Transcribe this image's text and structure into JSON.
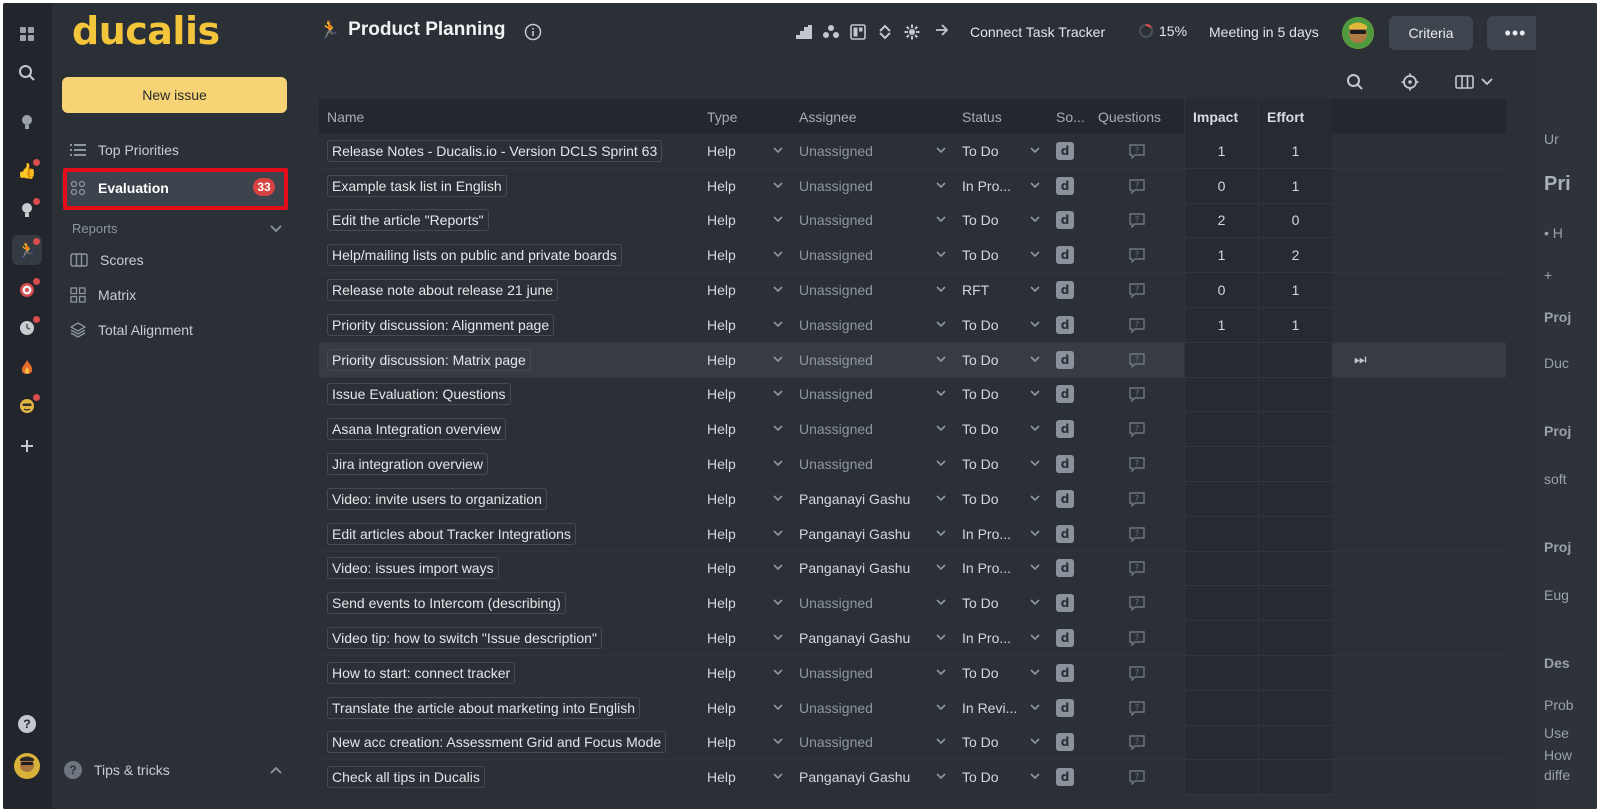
{
  "rail": {
    "icons": [
      "grid-icon",
      "search-icon",
      "bulb-icon",
      "thumbs-up-icon",
      "bulb-alert-icon",
      "runner-icon",
      "target-icon",
      "clock-icon",
      "fire-icon",
      "face-icon",
      "plus-icon",
      "help-icon",
      "user-avatar"
    ],
    "help_label": "?"
  },
  "sidebar": {
    "logo": "ducalis",
    "new_issue": "New issue",
    "items": [
      {
        "label": "Top Priorities"
      },
      {
        "label": "Evaluation",
        "badge": "33"
      }
    ],
    "reports_label": "Reports",
    "reports": [
      {
        "label": "Scores"
      },
      {
        "label": "Matrix"
      },
      {
        "label": "Total Alignment"
      }
    ],
    "tips": "Tips & tricks",
    "tips_icon": "?"
  },
  "header": {
    "title": "Product Planning",
    "connect": "Connect Task Tracker",
    "progress": "15%",
    "progress_value": 0.15,
    "meeting": "Meeting in 5 days",
    "criteria": "Criteria",
    "more": "•••"
  },
  "table": {
    "columns": {
      "name": "Name",
      "type": "Type",
      "assignee": "Assignee",
      "status": "Status",
      "so": "So...",
      "questions": "Questions",
      "impact": "Impact",
      "effort": "Effort"
    },
    "so_glyph": "d",
    "skip_glyph": "⏭",
    "rows": [
      {
        "name": "Release Notes - Ducalis.io - Version DCLS Sprint 63",
        "type": "Help",
        "assignee": "Unassigned",
        "status": "To Do",
        "impact": "1",
        "effort": "1"
      },
      {
        "name": "Example task list in English",
        "type": "Help",
        "assignee": "Unassigned",
        "status": "In Pro...",
        "impact": "0",
        "effort": "1"
      },
      {
        "name": "Edit the article \"Reports\"",
        "type": "Help",
        "assignee": "Unassigned",
        "status": "To Do",
        "impact": "2",
        "effort": "0"
      },
      {
        "name": "Help/mailing lists on public and private boards",
        "type": "Help",
        "assignee": "Unassigned",
        "status": "To Do",
        "impact": "1",
        "effort": "2"
      },
      {
        "name": "Release note about release 21 june",
        "type": "Help",
        "assignee": "Unassigned",
        "status": "RFT",
        "impact": "0",
        "effort": "1"
      },
      {
        "name": "Priority discussion: Alignment page",
        "type": "Help",
        "assignee": "Unassigned",
        "status": "To Do",
        "impact": "1",
        "effort": "1"
      },
      {
        "name": "Priority discussion: Matrix page",
        "type": "Help",
        "assignee": "Unassigned",
        "status": "To Do",
        "impact": "",
        "effort": "",
        "hover": true
      },
      {
        "name": "Issue Evaluation: Questions",
        "type": "Help",
        "assignee": "Unassigned",
        "status": "To Do",
        "impact": "",
        "effort": ""
      },
      {
        "name": "Asana Integration overview",
        "type": "Help",
        "assignee": "Unassigned",
        "status": "To Do",
        "impact": "",
        "effort": ""
      },
      {
        "name": "Jira integration overview",
        "type": "Help",
        "assignee": "Unassigned",
        "status": "To Do",
        "impact": "",
        "effort": ""
      },
      {
        "name": "Video: invite users to organization",
        "type": "Help",
        "assignee": "Panganayi Gashu",
        "status": "To Do",
        "impact": "",
        "effort": ""
      },
      {
        "name": "Edit articles about Tracker Integrations",
        "type": "Help",
        "assignee": "Panganayi Gashu",
        "status": "In Pro...",
        "impact": "",
        "effort": ""
      },
      {
        "name": "Video: issues import ways",
        "type": "Help",
        "assignee": "Panganayi Gashu",
        "status": "In Pro...",
        "impact": "",
        "effort": ""
      },
      {
        "name": "Send events to Intercom (describing)",
        "type": "Help",
        "assignee": "Unassigned",
        "status": "To Do",
        "impact": "",
        "effort": ""
      },
      {
        "name": "Video tip: how to switch \"Issue description\"",
        "type": "Help",
        "assignee": "Panganayi Gashu",
        "status": "In Pro...",
        "impact": "",
        "effort": ""
      },
      {
        "name": "How to start: connect tracker",
        "type": "Help",
        "assignee": "Unassigned",
        "status": "To Do",
        "impact": "",
        "effort": ""
      },
      {
        "name": "Translate the article about marketing into English",
        "type": "Help",
        "assignee": "Unassigned",
        "status": "In Revi...",
        "impact": "",
        "effort": ""
      },
      {
        "name": "New acc creation: Assessment Grid and Focus Mode",
        "type": "Help",
        "assignee": "Unassigned",
        "status": "To Do",
        "impact": "",
        "effort": ""
      },
      {
        "name": "Check all tips in Ducalis",
        "type": "Help",
        "assignee": "Panganayi Gashu",
        "status": "To Do",
        "impact": "",
        "effort": ""
      }
    ]
  },
  "right_panel": {
    "lines": [
      "Ur",
      "Pri",
      "• H",
      "+",
      "Proj",
      "Duc",
      "Proj",
      "soft",
      "Proj",
      "Eug",
      "Des",
      "Prob",
      "Use",
      "How",
      "diffe"
    ]
  },
  "colors": {
    "accent": "#f3c53b",
    "badge": "#d64141",
    "highlight": "#e30d1a",
    "chat": "#d95b5b"
  }
}
